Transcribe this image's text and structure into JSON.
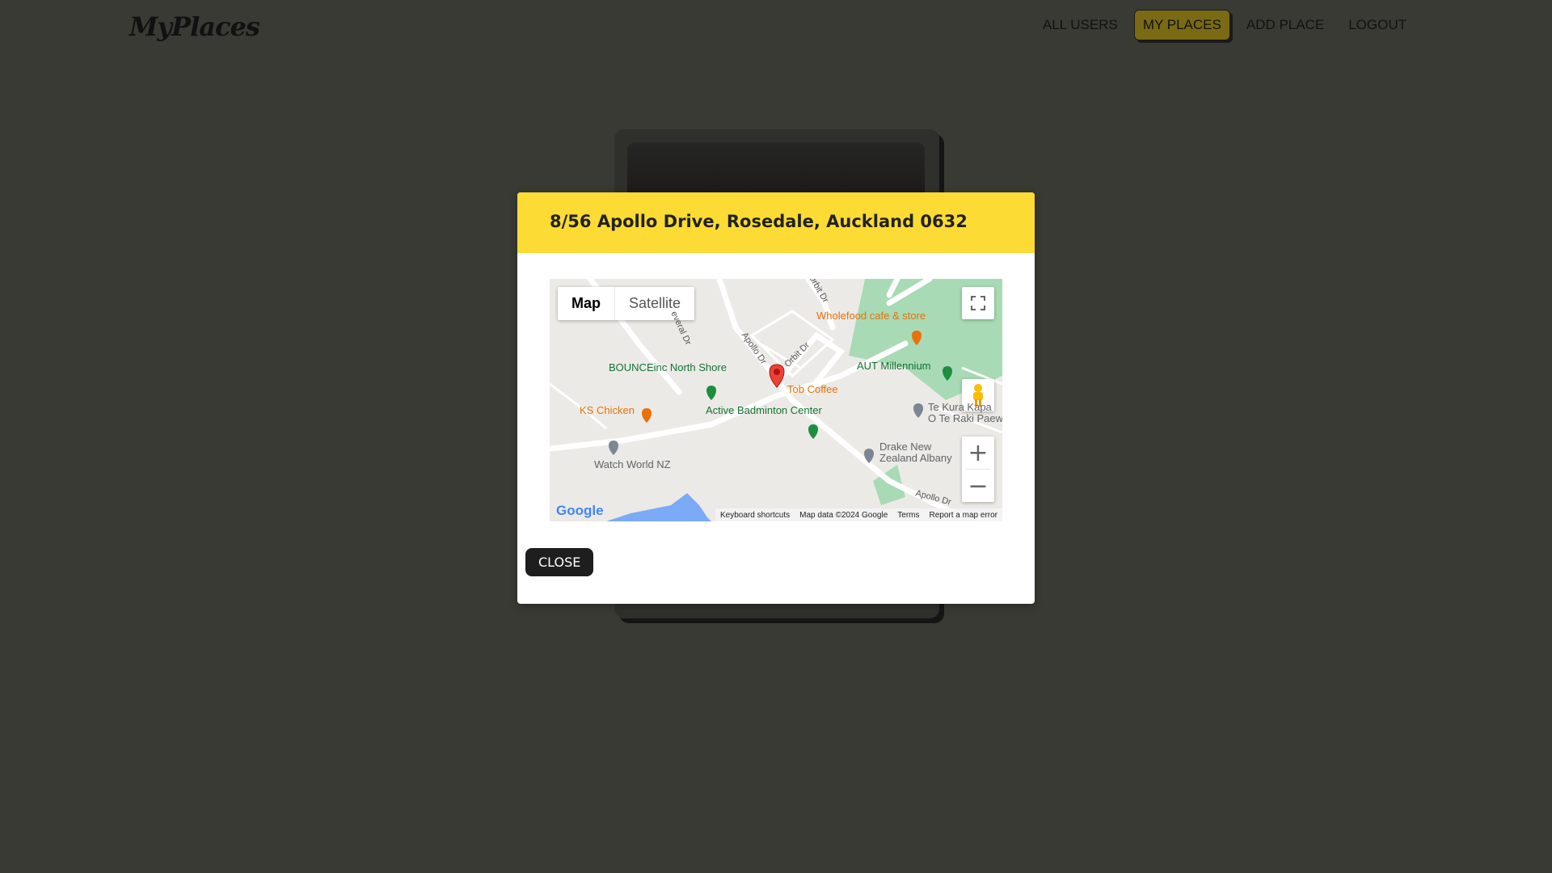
{
  "header": {
    "logo": "MyPlaces",
    "nav": [
      {
        "label": "ALL USERS",
        "active": false
      },
      {
        "label": "MY PLACES",
        "active": true
      },
      {
        "label": "ADD PLACE",
        "active": false
      },
      {
        "label": "LOGOUT",
        "active": false
      }
    ]
  },
  "modal": {
    "title": "8/56 Apollo Drive, Rosedale, Auckland 0632",
    "close_label": "CLOSE"
  },
  "map": {
    "map_type_map": "Map",
    "map_type_satellite": "Satellite",
    "zoom_in": "+",
    "zoom_out": "−",
    "pois": {
      "wholefood": "Wholefood cafe & store",
      "aut": "AUT Millennium",
      "bounce": "BOUNCEinc North Shore",
      "tob": "Tob Coffee",
      "ks": "KS Chicken",
      "badminton": "Active Badminton Center",
      "tekura1": "Te Kura Kapa",
      "tekura2": "O Te Raki Paew",
      "drake1": "Drake New",
      "drake2": "Zealand Albany",
      "watch": "Watch World NZ"
    },
    "roads": {
      "apollo1": "Apollo Dr",
      "apollo2": "Apollo Dr",
      "orbit1": "Orbit Dr",
      "orbit2": "Orbit Dr",
      "everal": "everal Dr"
    },
    "footer": {
      "keyboard": "Keyboard shortcuts",
      "mapdata": "Map data ©2024 Google",
      "terms": "Terms",
      "report": "Report a map error"
    },
    "google_logo": "Google"
  },
  "colors": {
    "accent": "#fcdb35",
    "background": "#3a3a34"
  }
}
